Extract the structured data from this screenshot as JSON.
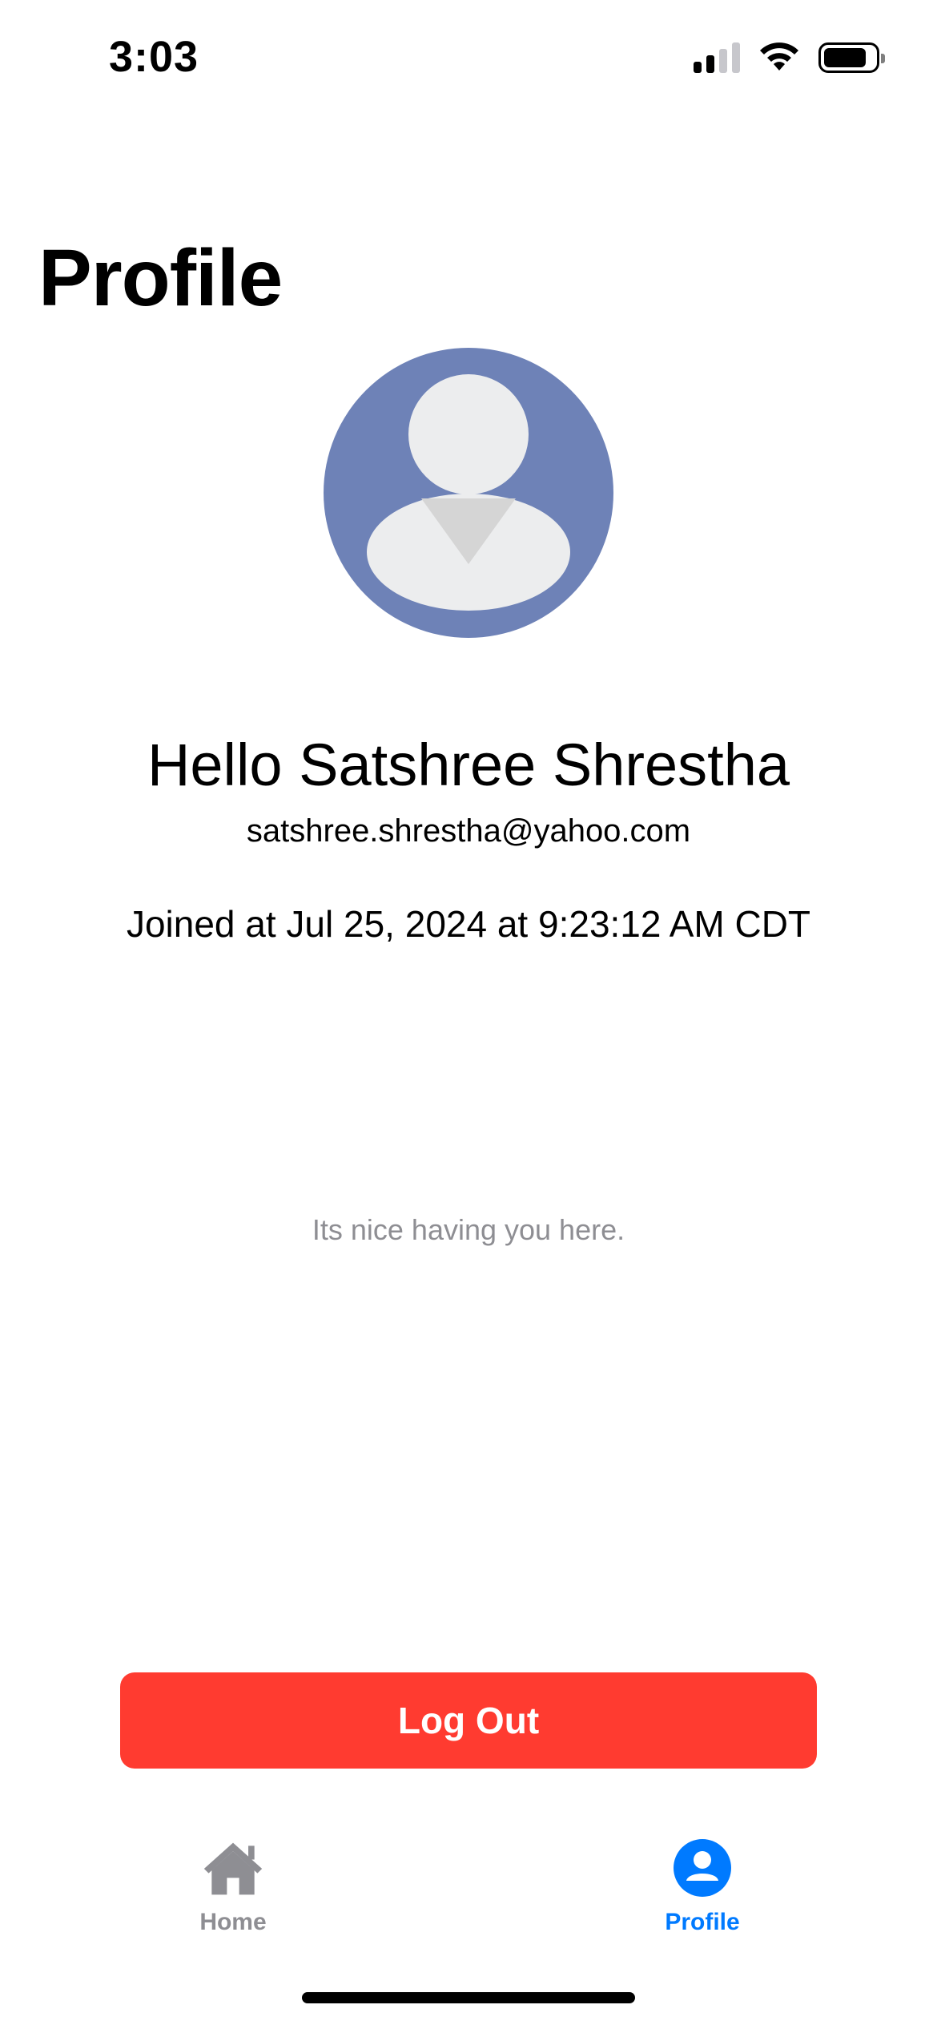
{
  "status_bar": {
    "time": "3:03",
    "signal_icon": "cellular-signal-icon",
    "wifi_icon": "wifi-icon",
    "battery_icon": "battery-icon"
  },
  "page": {
    "title": "Profile"
  },
  "profile": {
    "avatar_icon": "person-avatar-icon",
    "avatar_color": "#6e82b7",
    "greeting": "Hello Satshree Shrestha",
    "email": "satshree.shrestha@yahoo.com",
    "joined": "Joined at Jul 25, 2024 at 9:23:12 AM CDT",
    "message": "Its nice having you here."
  },
  "actions": {
    "logout_label": "Log Out",
    "logout_color": "#ff3b30"
  },
  "tab_bar": {
    "tabs": [
      {
        "label": "Home",
        "icon": "house-icon",
        "selected": false
      },
      {
        "label": "Profile",
        "icon": "person-circle-icon",
        "selected": true
      }
    ],
    "active_color": "#007aff",
    "inactive_color": "#8e8e93"
  }
}
